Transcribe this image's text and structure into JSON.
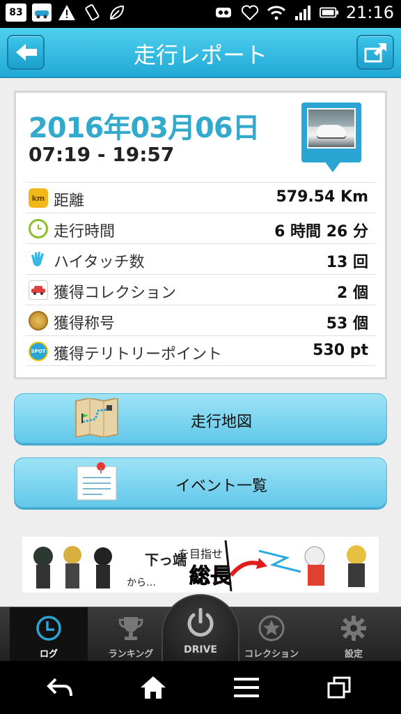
{
  "status_bar": {
    "time": "21:16",
    "left_icons": [
      "sim-icon",
      "app-icon",
      "warning-icon",
      "vibrate-icon",
      "leaf-icon"
    ],
    "right_icons": [
      "app2-icon",
      "heart-icon",
      "wifi-icon",
      "signal-icon",
      "battery-icon"
    ],
    "left_text": "83"
  },
  "header": {
    "title": "走行レポート"
  },
  "report": {
    "date": "2016年03月06日",
    "time_range": "07:19 - 19:57",
    "stats": [
      {
        "label": "距離",
        "value": "579.54 Km",
        "icon": "km-icon",
        "icon_text": "km"
      },
      {
        "label": "走行時間",
        "value": "6 時間 26 分",
        "icon": "clock-icon",
        "icon_text": ""
      },
      {
        "label": "ハイタッチ数",
        "value": "13 回",
        "icon": "hand-icon",
        "icon_text": ""
      },
      {
        "label": "獲得コレクション",
        "value": "2 個",
        "icon": "car-icon",
        "icon_text": ""
      },
      {
        "label": "獲得称号",
        "value": "53 個",
        "icon": "medal-icon",
        "icon_text": ""
      },
      {
        "label": "獲得テリトリーポイント",
        "value": "530 pt",
        "icon": "spot-icon",
        "icon_text": "SPOT"
      }
    ]
  },
  "buttons": {
    "map_label": "走行地図",
    "event_label": "イベント一覧"
  },
  "tabs": [
    {
      "label": "ログ",
      "icon": "clock-icon",
      "active": true
    },
    {
      "label": "ランキング",
      "icon": "trophy-icon",
      "active": false
    },
    {
      "label": "DRIVE",
      "icon": "power-icon",
      "active": false
    },
    {
      "label": "コレクション",
      "icon": "star-icon",
      "active": false
    },
    {
      "label": "設定",
      "icon": "gear-icon",
      "active": false
    }
  ],
  "banner": {
    "text": "総長を目指せ下っ端から…"
  },
  "colors": {
    "accent": "#21a9d6",
    "date": "#33aacc",
    "button": "#62c8ea"
  }
}
